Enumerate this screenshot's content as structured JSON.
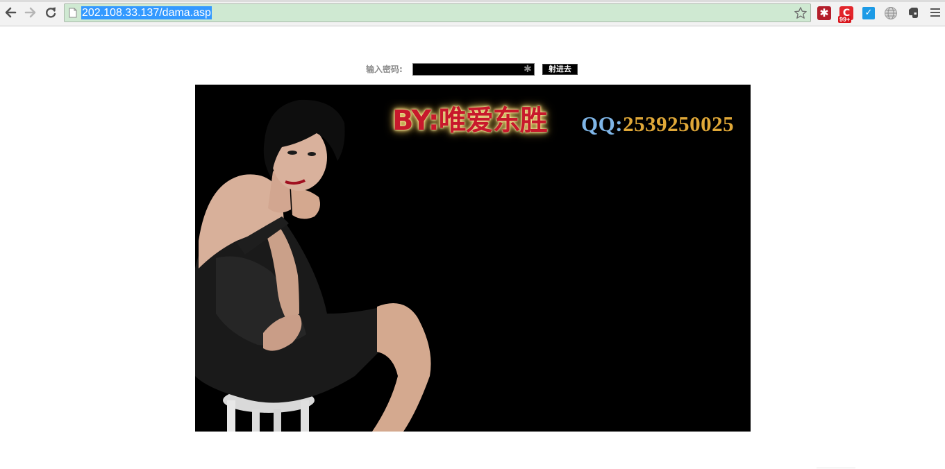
{
  "browser": {
    "url": "202.108.33.137/dama.asp",
    "icons": {
      "back": "back-arrow-icon",
      "forward": "forward-arrow-icon",
      "reload": "reload-icon",
      "page": "page-icon",
      "bookmark": "star-icon",
      "menu": "hamburger-menu-icon"
    },
    "extensions": [
      {
        "name": "red-asterisk-extension",
        "glyph": "✱"
      },
      {
        "name": "c-extension",
        "glyph": "C",
        "badge": "99+"
      },
      {
        "name": "check-extension",
        "glyph": "✓"
      },
      {
        "name": "globe-extension"
      },
      {
        "name": "evernote-extension"
      }
    ],
    "omnibox_color": "#cfe9d2",
    "selection_color": "#3399ff"
  },
  "login": {
    "label": "输入密码:",
    "asterisk": "✱",
    "submit_label": "射进去"
  },
  "banner": {
    "by_text": "BY:唯爱东胜",
    "qq_prefix": "QQ:",
    "qq_number": "2539250025",
    "background": "#000000"
  }
}
